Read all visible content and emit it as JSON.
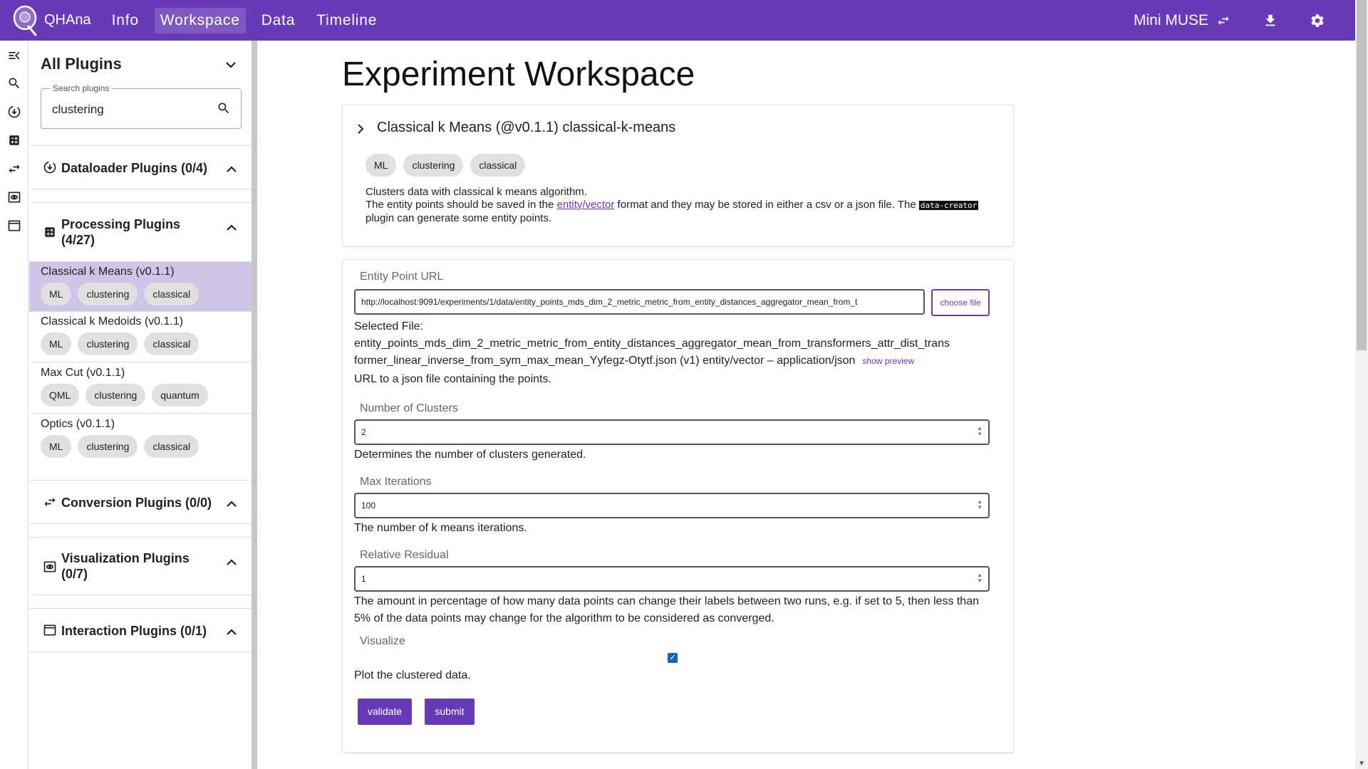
{
  "topbar": {
    "brand": "QHAna",
    "nav": [
      "Info",
      "Workspace",
      "Data",
      "Timeline"
    ],
    "active_nav": "Workspace",
    "experiment_name": "Mini MUSE",
    "accent_color": "#673ab7"
  },
  "rail": {
    "icons": [
      "collapse-menu-icon",
      "search-icon",
      "dataloader-icon",
      "calculator-icon",
      "convert-icon",
      "eye-icon",
      "window-icon"
    ]
  },
  "sidebar": {
    "title": "All Plugins",
    "search": {
      "label": "Search plugins",
      "value": "clustering"
    },
    "sections": {
      "dataloader": {
        "title": "Dataloader Plugins (0/4)"
      },
      "processing": {
        "title": "Processing Plugins (4/27)"
      },
      "conversion": {
        "title": "Conversion Plugins (0/0)"
      },
      "visualization": {
        "title": "Visualization Plugins (0/7)"
      },
      "interaction": {
        "title": "Interaction Plugins (0/1)"
      }
    },
    "plugins": [
      {
        "name": "Classical k Means (v0.1.1)",
        "tags": [
          "ML",
          "clustering",
          "classical"
        ],
        "selected": true
      },
      {
        "name": "Classical k Medoids (v0.1.1)",
        "tags": [
          "ML",
          "clustering",
          "classical"
        ],
        "selected": false
      },
      {
        "name": "Max Cut (v0.1.1)",
        "tags": [
          "QML",
          "clustering",
          "quantum"
        ],
        "selected": false
      },
      {
        "name": "Optics (v0.1.1)",
        "tags": [
          "ML",
          "clustering",
          "classical"
        ],
        "selected": false
      }
    ]
  },
  "main": {
    "title": "Experiment Workspace",
    "plugin_card": {
      "header": "Classical k Means (@v0.1.1) classical-k-means",
      "tags": [
        "ML",
        "clustering",
        "classical"
      ],
      "desc_line1": "Clusters data with classical k means algorithm.",
      "desc_part1": "The entity points should be saved in the ",
      "desc_link": "entity/vector",
      "desc_part2": " format and they may be stored in either a csv or a json file. The ",
      "desc_code": "data-creator",
      "desc_part3": " plugin can generate some entity points."
    },
    "form": {
      "entity_url": {
        "label": "Entity Point URL",
        "value": "http://localhost:9091/experiments/1/data/entity_points_mds_dim_2_metric_metric_from_entity_distances_aggregator_mean_from_t",
        "choose_label": "choose file",
        "selected_label": "Selected File:",
        "selected_file": "entity_points_mds_dim_2_metric_metric_from_entity_distances_aggregator_mean_from_transformers_attr_dist_trans",
        "selected_file_2": "former_linear_inverse_from_sym_max_mean_Yyfegz-Otytf.json (v1) entity/vector – application/json",
        "preview_label": "show preview",
        "help": "URL to a json file containing the points."
      },
      "clusters": {
        "label": "Number of Clusters",
        "value": "2",
        "help": "Determines the number of clusters generated."
      },
      "iterations": {
        "label": "Max Iterations",
        "value": "100",
        "help": "The number of k means iterations."
      },
      "residual": {
        "label": "Relative Residual",
        "value": "1",
        "help": "The amount in percentage of how many data points can change their labels between two runs, e.g. if set to 5, then less than 5% of the data points may change for the algorithm to be considered as converged."
      },
      "visualize": {
        "label": "Visualize",
        "checked": true,
        "help": "Plot the clustered data."
      },
      "validate_label": "validate",
      "submit_label": "submit"
    }
  }
}
